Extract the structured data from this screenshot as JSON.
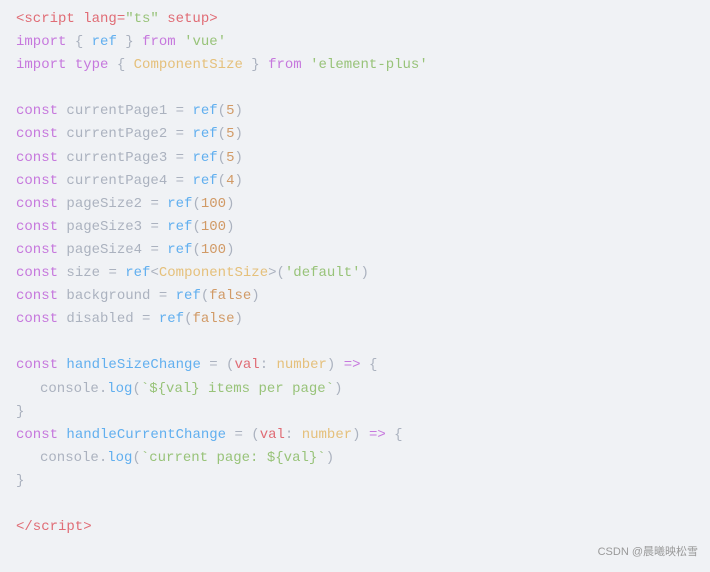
{
  "code": {
    "lines": [
      {
        "id": "line1",
        "type": "tag",
        "content": "<script lang=\"ts\" setup>"
      },
      {
        "id": "line2",
        "type": "import-ref",
        "content": "import { ref } from 'vue'"
      },
      {
        "id": "line3",
        "type": "import-type",
        "content": "import type { ComponentSize } from 'element-plus'"
      },
      {
        "id": "line4",
        "type": "blank"
      },
      {
        "id": "line5",
        "type": "const-ref-num",
        "varName": "currentPage1",
        "val": "5"
      },
      {
        "id": "line6",
        "type": "const-ref-num",
        "varName": "currentPage2",
        "val": "5"
      },
      {
        "id": "line7",
        "type": "const-ref-num",
        "varName": "currentPage3",
        "val": "5"
      },
      {
        "id": "line8",
        "type": "const-ref-num",
        "varName": "currentPage4",
        "val": "4"
      },
      {
        "id": "line9",
        "type": "const-ref-num",
        "varName": "pageSize2",
        "val": "100"
      },
      {
        "id": "line10",
        "type": "const-ref-num",
        "varName": "pageSize3",
        "val": "100"
      },
      {
        "id": "line11",
        "type": "const-ref-num",
        "varName": "pageSize4",
        "val": "100"
      },
      {
        "id": "line12",
        "type": "const-ref-type",
        "varName": "size"
      },
      {
        "id": "line13",
        "type": "const-ref-bool",
        "varName": "background"
      },
      {
        "id": "line14",
        "type": "const-ref-bool",
        "varName": "disabled"
      },
      {
        "id": "line15",
        "type": "blank"
      },
      {
        "id": "line16",
        "type": "fn-size-change"
      },
      {
        "id": "line17",
        "type": "console-items"
      },
      {
        "id": "line18",
        "type": "close-brace"
      },
      {
        "id": "line19",
        "type": "fn-current-change"
      },
      {
        "id": "line20",
        "type": "console-current"
      },
      {
        "id": "line21",
        "type": "close-brace"
      },
      {
        "id": "line22",
        "type": "blank"
      },
      {
        "id": "line23",
        "type": "close-script"
      }
    ],
    "watermark": "CSDN @晨曦映松雪"
  }
}
